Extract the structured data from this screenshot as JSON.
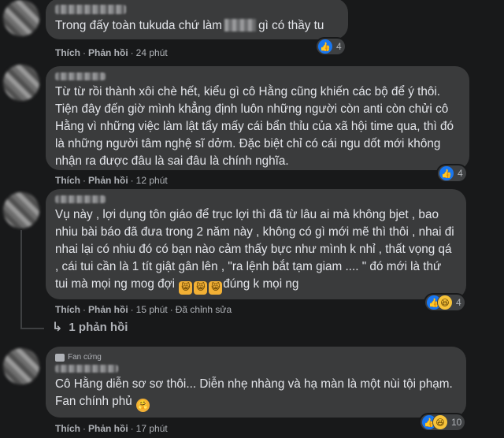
{
  "actions": {
    "like": "Thích",
    "reply": "Phản hồi",
    "edited": "Đã chỉnh sửa"
  },
  "comments": [
    {
      "text_before": "Trong đấy toàn tukuda chứ làm",
      "text_after": "gì có thầy tu",
      "time": "24 phút",
      "reaction_count": "4"
    },
    {
      "text": "Từ từ rồi thành xôi chè hết, kiểu gì cô Hằng cũng khiến các bộ để ý thôi. Tiện đây đến giờ mình khẳng định luôn những người còn anti còn chửi cô Hằng vì những việc làm lật tẩy mấy cái bẩn thỉu của xã hội time qua, thì đó là những người tâm nghệ sĩ dởm. Đặc biệt chỉ có cái ngu dốt mới không nhận ra được đâu là sai đâu là chính nghĩa.",
      "time": "12 phút",
      "reaction_count": "4"
    },
    {
      "text": "Vụ này , lợi dụng tôn giáo để trục lợi thì đã từ lâu ai mà không bjet , bao nhiu bài báo đã đưa trong 2 năm này , không có gì mới mẽ thì thôi , nhai đi nhai lại có nhiu đó có bạn nào cảm thấy bực như mình k nhỉ , thất vọng qá , cái tui cần là 1 tít giật gân lên , \"ra lệnh bắt tạm giam .... \" đó mới là thứ tui mà mọi ng mog đợi",
      "text_end": "đúng k mọi ng",
      "time": "15 phút",
      "reaction_count": "4"
    },
    {
      "badge": "Fan cứng",
      "text": "Cô Hằng diễn sơ sơ thôi... Diễn nhẹ nhàng và hạ màn là một nùi tội phạm. Fan chính phủ",
      "time": "17 phút",
      "reaction_count": "10"
    }
  ],
  "replies_link": "1 phản hồi",
  "icons": {
    "like": "like-icon",
    "haha": "haha-icon",
    "cat_emoji": "grinning-cat-emoji",
    "hugging_emoji": "hugging-face-emoji",
    "reply_arrow": "reply-arrow-icon"
  },
  "colors": {
    "background": "#18191a",
    "bubble": "#3a3b3c",
    "like_blue": "#1877f2",
    "meta_text": "#b0b3b8"
  }
}
